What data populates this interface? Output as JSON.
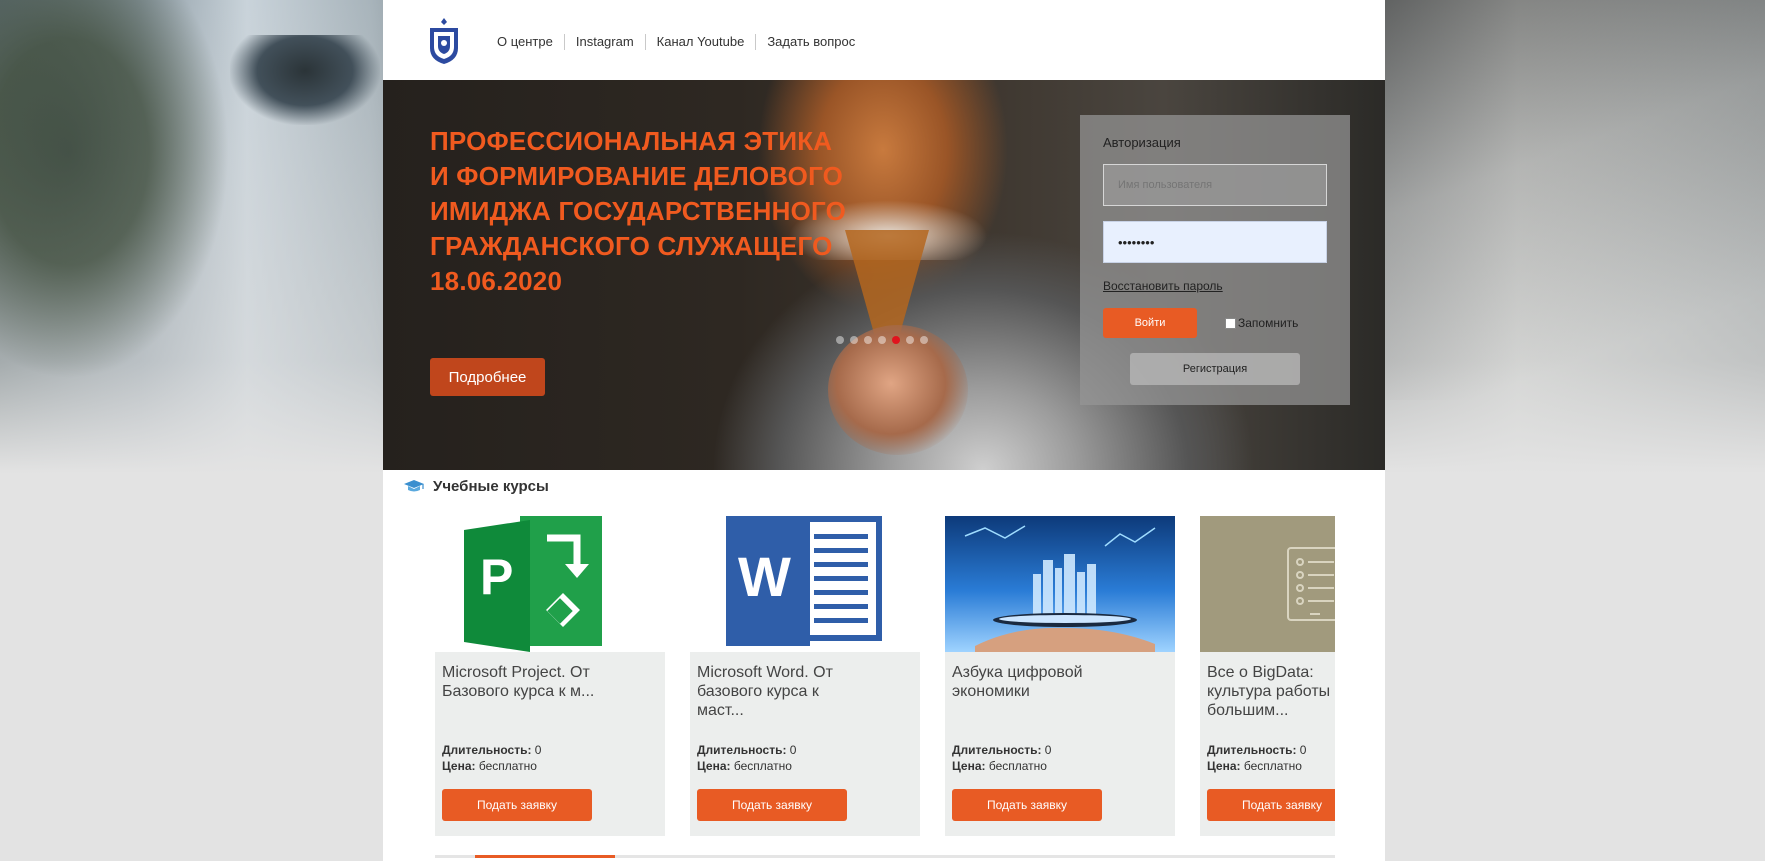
{
  "nav": {
    "items": [
      {
        "label": "О центре"
      },
      {
        "label": "Instagram"
      },
      {
        "label": "Канал Youtube"
      },
      {
        "label": "Задать вопрос"
      }
    ]
  },
  "banner": {
    "title": "ПРОФЕССИОНАЛЬНАЯ ЭТИКА И ФОРМИРОВАНИЕ ДЕЛОВОГО ИМИДЖА ГОСУДАРСТВЕННОГО ГРАЖДАНСКОГО СЛУЖАЩЕГО 18.06.2020",
    "button_label": "Подробнее",
    "slides_total": 7,
    "active_slide": 5
  },
  "auth": {
    "title": "Авторизация",
    "username_placeholder": "Имя пользователя",
    "password_value": "••••••••",
    "restore_label": "Восстановить пароль",
    "login_label": "Войти",
    "remember_label": "Запомнить",
    "register_label": "Регистрация"
  },
  "courses": {
    "heading": "Учебные курсы",
    "items": [
      {
        "title": "Microsoft Project. От\nБазового курса к м...",
        "duration_label": "Длительность:",
        "duration": "0",
        "price_label": "Цена:",
        "price": "бесплатно",
        "button": "Подать заявку",
        "image": "ms-project-logo"
      },
      {
        "title": "Microsoft Word. От\nбазового курса к\nмаст...",
        "duration_label": "Длительность:",
        "duration": "0",
        "price_label": "Цена:",
        "price": "бесплатно",
        "button": "Подать заявку",
        "image": "ms-word-logo"
      },
      {
        "title": "Азбука цифровой\nэкономики",
        "duration_label": "Длительность:",
        "duration": "0",
        "price_label": "Цена:",
        "price": "бесплатно",
        "button": "Подать заявку",
        "image": "digital-city-tablet"
      },
      {
        "title": "Все о BigData:\nкультура работы\nбольшим...",
        "duration_label": "Длительность:",
        "duration": "0",
        "price_label": "Цена:",
        "price": "бесплатно",
        "button": "Подать заявку",
        "image": "bigdata-list-icon"
      }
    ]
  },
  "colors": {
    "accent": "#e85b24",
    "banner_title": "#f05a1f",
    "active_dot": "#e0141e"
  }
}
